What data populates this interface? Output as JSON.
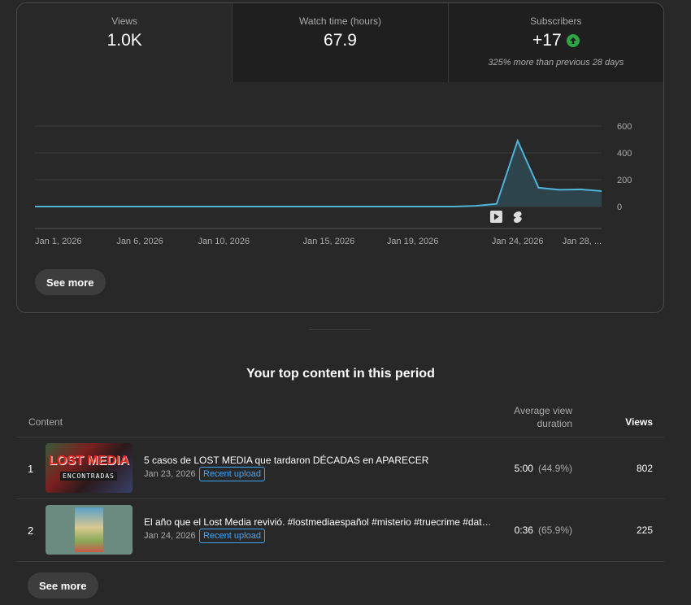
{
  "metrics": [
    {
      "label": "Views",
      "value": "1.0K"
    },
    {
      "label": "Watch time (hours)",
      "value": "67.9"
    },
    {
      "label": "Subscribers",
      "value": "+17",
      "note": "325% more than previous 28 days",
      "trend_icon": "arrow-up-icon",
      "trend_color": "#2ba640"
    }
  ],
  "chart_data": {
    "type": "area",
    "x": [
      "Jan 1",
      "Jan 2",
      "Jan 3",
      "Jan 4",
      "Jan 5",
      "Jan 6",
      "Jan 7",
      "Jan 8",
      "Jan 9",
      "Jan 10",
      "Jan 11",
      "Jan 12",
      "Jan 13",
      "Jan 14",
      "Jan 15",
      "Jan 16",
      "Jan 17",
      "Jan 18",
      "Jan 19",
      "Jan 20",
      "Jan 21",
      "Jan 22",
      "Jan 23",
      "Jan 24",
      "Jan 25",
      "Jan 26",
      "Jan 27",
      "Jan 28"
    ],
    "values": [
      0,
      0,
      0,
      0,
      0,
      0,
      0,
      0,
      0,
      0,
      0,
      0,
      0,
      0,
      0,
      0,
      0,
      0,
      0,
      0,
      0,
      5,
      20,
      490,
      140,
      125,
      128,
      115
    ],
    "x_tick_labels": [
      "Jan 1, 2026",
      "Jan 6, 2026",
      "Jan 10, 2026",
      "Jan 15, 2026",
      "Jan 19, 2026",
      "Jan 24, 2026",
      "Jan 28, ..."
    ],
    "x_tick_indices": [
      0,
      5,
      9,
      14,
      18,
      23,
      27
    ],
    "y_ticks": [
      "0",
      "200",
      "400",
      "600"
    ],
    "ylim": [
      0,
      600
    ],
    "grid": true,
    "line_color": "#4fb4d8",
    "markers": [
      {
        "index": 22,
        "icon": "video-play-icon"
      },
      {
        "index": 23,
        "icon": "shorts-icon"
      }
    ]
  },
  "chart_section": {
    "see_more": "See more"
  },
  "top_content": {
    "title": "Your top content in this period",
    "headers": {
      "content": "Content",
      "avg_duration": "Average view duration",
      "views": "Views"
    },
    "rows": [
      {
        "rank": "1",
        "title": "5 casos de LOST MEDIA que tardaron DÉCADAS en APARECER",
        "date": "Jan 23, 2026",
        "badge": "Recent upload",
        "duration": "5:00",
        "pct": "(44.9%)",
        "views": "802",
        "thumb_text": "LOST MEDIA",
        "thumb_sub": "ENCONTRADAS"
      },
      {
        "rank": "2",
        "title": "El año que el Lost Media revivió. #lostmediaespañol #misterio #truecrime #dato…",
        "date": "Jan 24, 2026",
        "badge": "Recent upload",
        "duration": "0:36",
        "pct": "(65.9%)",
        "views": "225"
      }
    ],
    "see_more": "See more"
  }
}
